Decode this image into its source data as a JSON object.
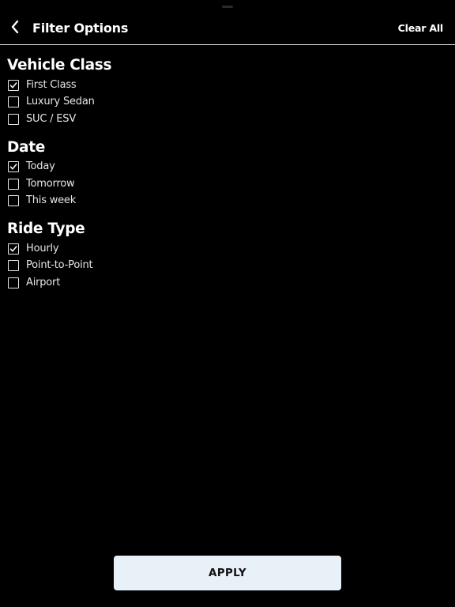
{
  "header": {
    "title": "Filter Options",
    "clear_label": "Clear All",
    "back_icon": "chevron-left-icon"
  },
  "sections": [
    {
      "title": "Vehicle Class",
      "options": [
        {
          "label": "First Class",
          "checked": true
        },
        {
          "label": "Luxury Sedan",
          "checked": false
        },
        {
          "label": "SUC / ESV",
          "checked": false
        }
      ]
    },
    {
      "title": "Date",
      "options": [
        {
          "label": "Today",
          "checked": true
        },
        {
          "label": "Tomorrow",
          "checked": false
        },
        {
          "label": "This week",
          "checked": false
        }
      ]
    },
    {
      "title": "Ride Type",
      "options": [
        {
          "label": "Hourly",
          "checked": true
        },
        {
          "label": "Point-to-Point",
          "checked": false
        },
        {
          "label": "Airport",
          "checked": false
        }
      ]
    }
  ],
  "footer": {
    "apply_label": "APPLY"
  },
  "colors": {
    "background": "#000000",
    "text": "#ffffff",
    "apply_button": "#e9f1f8"
  }
}
